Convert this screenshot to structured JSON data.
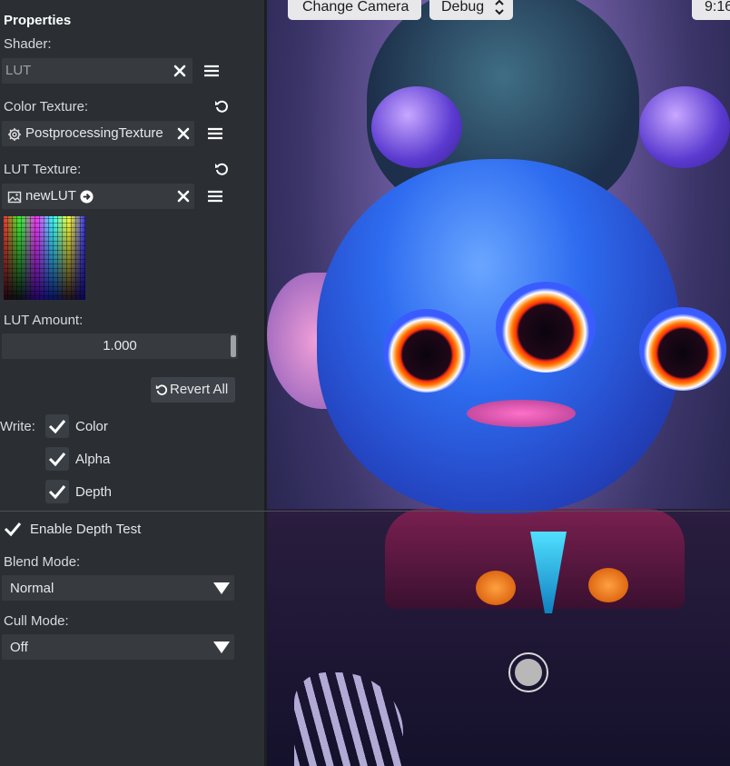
{
  "panel": {
    "title": "Properties",
    "shader": {
      "label": "Shader:",
      "value": "LUT"
    },
    "color_texture": {
      "label": "Color Texture:",
      "value": "PostprocessingTexture"
    },
    "lut_texture": {
      "label": "LUT Texture:",
      "value": "newLUT"
    },
    "lut_amount": {
      "label": "LUT Amount:",
      "value": "1.000"
    },
    "revert_all": "Revert All",
    "write": {
      "label": "Write:",
      "color": "Color",
      "alpha": "Alpha",
      "depth": "Depth"
    },
    "enable_depth_test": "Enable Depth Test",
    "blend_mode": {
      "label": "Blend Mode:",
      "value": "Normal"
    },
    "cull_mode": {
      "label": "Cull Mode:",
      "value": "Off"
    }
  },
  "preview": {
    "change_camera": "Change Camera",
    "debug": "Debug",
    "time": "9:16"
  },
  "colors": {
    "panel_bg": "#2b2f34",
    "field_bg": "#373b40",
    "text": "#e4e6e8"
  },
  "icons": [
    "close-icon",
    "menu-icon",
    "reset-icon",
    "gear-icon",
    "image-icon",
    "arrow-right-circle-icon",
    "revert-icon",
    "checkmark-icon",
    "dropdown-arrow-icon",
    "updown-chevron-icon",
    "shutter-icon"
  ]
}
